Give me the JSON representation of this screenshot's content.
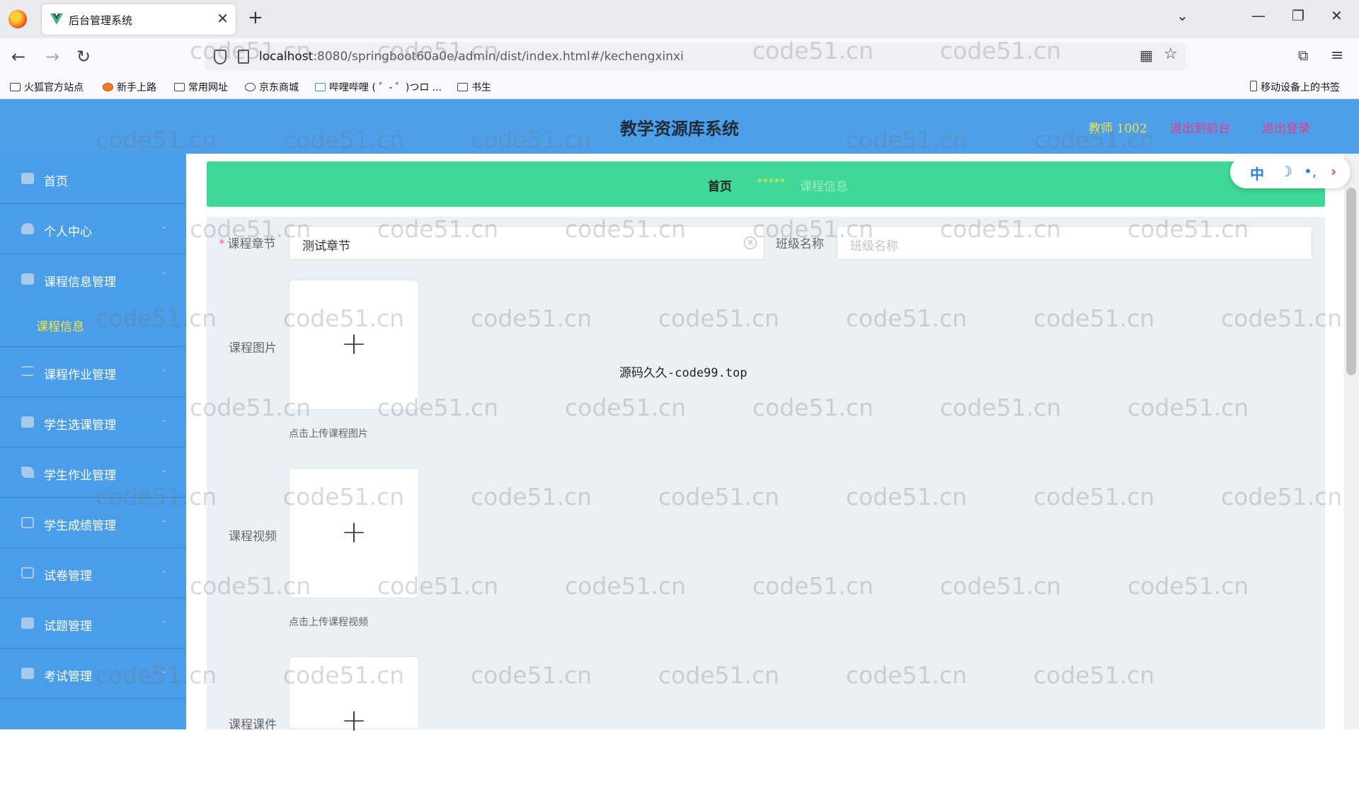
{
  "browser": {
    "tab_title": "后台管理系统",
    "url_host": "localhost",
    "url_rest": ":8080/springboot60a0e/admin/dist/index.html#/kechengxinxi",
    "bookmarks": [
      "火狐官方站点",
      "新手上路",
      "常用网址",
      "京东商城",
      "哔哩哔哩 ( ゜- ゜)つロ ...",
      "书生"
    ],
    "mobile_bookmarks": "移动设备上的书签"
  },
  "header": {
    "title": "教学资源库系统",
    "user": "教师 1002",
    "back_to_front": "退出到前台",
    "logout": "退出登录"
  },
  "sidebar": {
    "items": [
      {
        "label": "首页"
      },
      {
        "label": "个人中心"
      },
      {
        "label": "课程信息管理"
      },
      {
        "label": "课程作业管理"
      },
      {
        "label": "学生选课管理"
      },
      {
        "label": "学生作业管理"
      },
      {
        "label": "学生成绩管理"
      },
      {
        "label": "试卷管理"
      },
      {
        "label": "试题管理"
      },
      {
        "label": "考试管理"
      }
    ],
    "sub_item": "课程信息"
  },
  "breadcrumb": {
    "home": "首页",
    "separator": "*****",
    "current": "课程信息"
  },
  "form": {
    "chapter_label": "课程章节",
    "chapter_value": "测试章节",
    "class_label": "班级名称",
    "class_placeholder": "班级名称",
    "image_label": "课程图片",
    "image_tip": "点击上传课程图片",
    "video_label": "课程视频",
    "video_tip": "点击上传课程视频",
    "courseware_label": "课程课件"
  },
  "float_tool": [
    "中",
    "☽",
    "•,",
    "›"
  ],
  "watermark": "code51.cn",
  "center_mark": "源码久久-code99.top"
}
